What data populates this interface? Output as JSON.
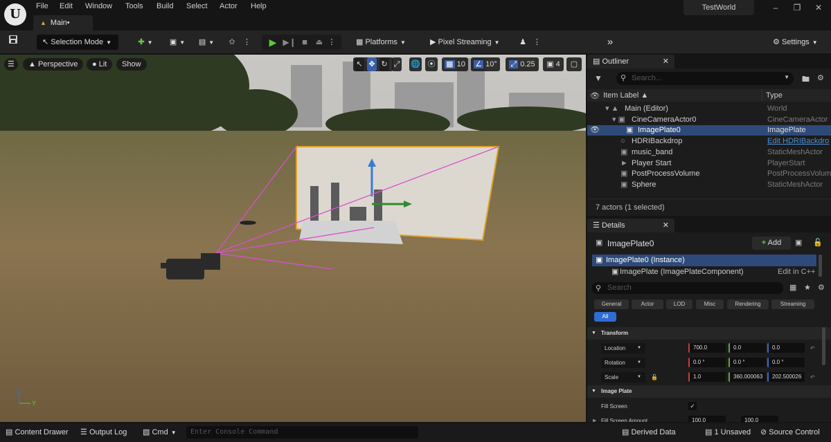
{
  "menu": {
    "items": [
      "File",
      "Edit",
      "Window",
      "Tools",
      "Build",
      "Select",
      "Actor",
      "Help"
    ]
  },
  "title_tab": "Main•",
  "project_name": "TestWorld",
  "toolbar": {
    "mode": "Selection Mode",
    "platforms": "Platforms",
    "pixel_streaming": "Pixel Streaming",
    "settings": "Settings"
  },
  "viewport": {
    "perspective": "Perspective",
    "lit": "Lit",
    "show": "Show",
    "grid_snap": "10",
    "rot_snap": "10°",
    "scale_snap": "0.25",
    "cam_speed": "4",
    "axis_z": "Z",
    "axis_y": "Y"
  },
  "outliner": {
    "tab": "Outliner",
    "search_placeholder": "Search...",
    "col_label": "Item Label ▲",
    "col_type": "Type",
    "rows": [
      {
        "label": "Main (Editor)",
        "type": "World"
      },
      {
        "label": "CineCameraActor0",
        "type": "CineCameraActor"
      },
      {
        "label": "ImagePlate0",
        "type": "ImagePlate"
      },
      {
        "label": "HDRIBackdrop",
        "type": "Edit HDRIBackdro"
      },
      {
        "label": "music_band",
        "type": "StaticMeshActor"
      },
      {
        "label": "Player Start",
        "type": "PlayerStart"
      },
      {
        "label": "PostProcessVolume",
        "type": "PostProcessVolum"
      },
      {
        "label": "Sphere",
        "type": "StaticMeshActor"
      }
    ],
    "footer": "7 actors (1 selected)"
  },
  "details": {
    "tab": "Details",
    "object": "ImagePlate0",
    "add": "Add",
    "instance": "ImagePlate0 (Instance)",
    "component": "ImagePlate (ImagePlateComponent)",
    "edit_cpp": "Edit in C++",
    "search_placeholder": "Search",
    "chips": [
      "General",
      "Actor",
      "LOD",
      "Misc",
      "Rendering",
      "Streaming"
    ],
    "chip_all": "All",
    "section_transform": "Transform",
    "location": {
      "label": "Location",
      "x": "700.0",
      "y": "0.0",
      "z": "0.0"
    },
    "rotation": {
      "label": "Rotation",
      "x": "0.0 °",
      "y": "0.0 °",
      "z": "0.0 °"
    },
    "scale": {
      "label": "Scale",
      "x": "1.0",
      "y": "360.000063",
      "z": "202.500026"
    },
    "section_plate": "Image Plate",
    "fill_screen": "Fill Screen",
    "fill_amount_label": "Fill Screen Amount",
    "fill_amount_x": "100.0",
    "fill_amount_y": "100.0"
  },
  "status": {
    "content_drawer": "Content Drawer",
    "output_log": "Output Log",
    "cmd": "Cmd",
    "console_placeholder": "Enter Console Command",
    "derived_data": "Derived Data",
    "unsaved": "1 Unsaved",
    "source_control": "Source Control"
  }
}
